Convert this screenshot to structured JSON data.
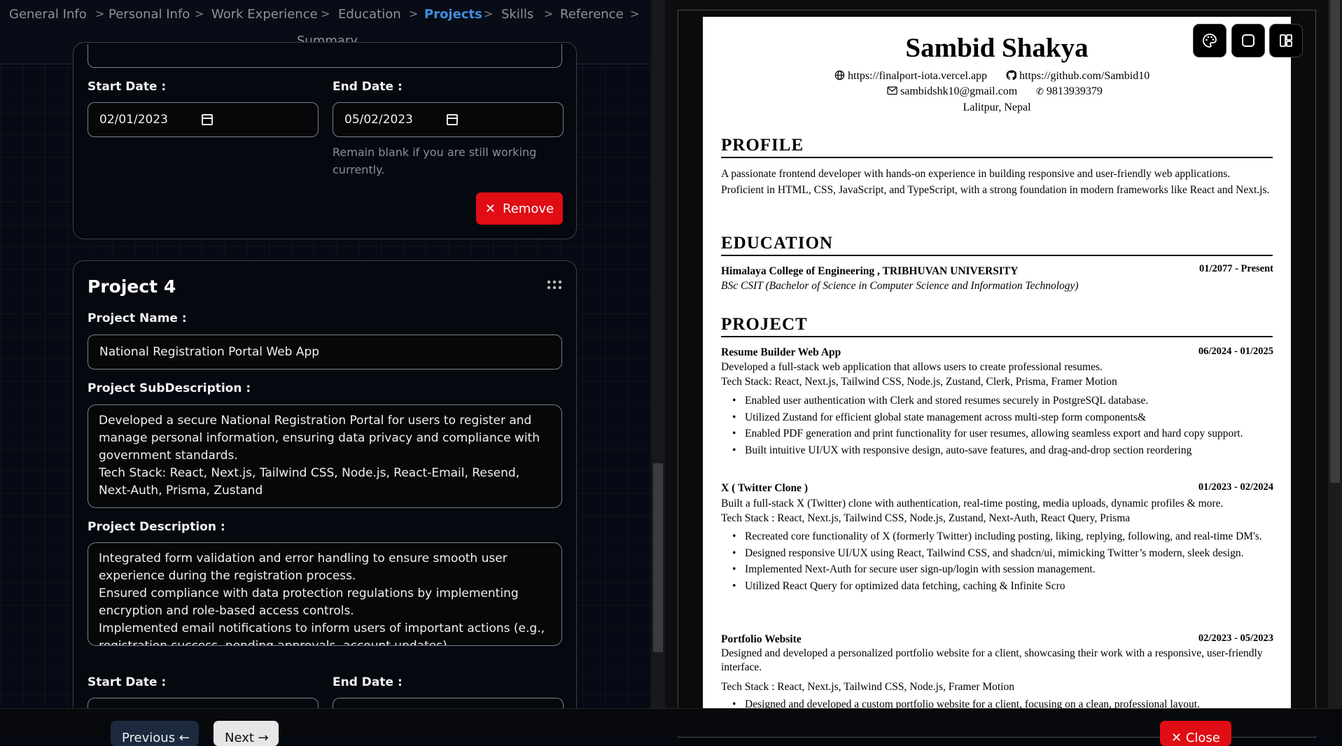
{
  "stepper": {
    "steps": [
      "General Info",
      "Personal Info",
      "Work Experience",
      "Education",
      "Projects",
      "Skills",
      "Reference",
      "Summary"
    ],
    "active": "Projects"
  },
  "project3": {
    "start_label": "Start Date :",
    "start_value": "02/01/2023",
    "end_label": "End Date :",
    "end_value": "05/02/2023",
    "end_hint": "Remain blank if you are still working currently.",
    "remove_label": "Remove"
  },
  "project4": {
    "title": "Project 4",
    "name_label": "Project Name :",
    "name_value": "National Registration Portal Web App",
    "subdesc_label": "Project SubDescription :",
    "subdesc_value": "Developed a secure National Registration Portal for users to register and manage personal information, ensuring data privacy and compliance with government standards.\nTech Stack: React, Next.js, Tailwind CSS, Node.js, React-Email, Resend, Next-Auth, Prisma, Zustand",
    "desc_label": "Project Description :",
    "desc_value": "Integrated form validation and error handling to ensure smooth user experience during the registration process.\nEnsured compliance with data protection regulations by implementing encryption and role-based access controls.\nImplemented email notifications to inform users of important actions (e.g., registration success, pending approvals, account updates).",
    "start_label": "Start Date :",
    "end_label": "End Date :"
  },
  "footer": {
    "previous": "Previous",
    "next": "Next",
    "close": "Close"
  },
  "toolbar_icons": [
    "palette-icon",
    "square-icon",
    "layout-icon"
  ],
  "resume": {
    "name": "Sambid Shakya",
    "website": "https://finalport-iota.vercel.app",
    "github": "https://github.com/Sambid10",
    "email": "sambidshk10@gmail.com",
    "phone": "9813939379",
    "location": "Lalitpur, Nepal",
    "profile_heading": "PROFILE",
    "profile_text": "A passionate frontend developer with hands-on experience in building responsive and user-friendly web applications. Proficient in HTML, CSS, JavaScript, and TypeScript, with a strong foundation in modern frameworks like React and Next.js.",
    "education_heading": "EDUCATION",
    "education": {
      "school": "Himalaya College of Engineering , TRIBHUVAN UNIVERSITY",
      "date": "01/2077 - Present",
      "degree": "BSc CSIT (Bachelor of Science in Computer Science and Information Technology)"
    },
    "project_heading": "PROJECT",
    "projects": [
      {
        "name": "Resume Builder Web App",
        "date": "06/2024 - 01/2025",
        "desc": "Developed a full-stack web application that allows users to create professional resumes.",
        "stack": "Tech Stack: React, Next.js, Tailwind CSS, Node.js, Zustand, Clerk, Prisma, Framer Motion",
        "bullets": [
          "Enabled user authentication with Clerk and stored resumes securely in PostgreSQL database.",
          "Utilized Zustand for efficient global state management across multi-step form components&",
          "Enabled PDF generation and print functionality for user resumes, allowing seamless export and hard copy support.",
          "Built intuitive UI/UX with responsive design, auto-save features, and drag-and-drop section reordering"
        ]
      },
      {
        "name": "X ( Twitter Clone )",
        "date": "01/2023 - 02/2024",
        "desc": "Built a full-stack X (Twitter) clone with authentication, real-time posting, media uploads, dynamic profiles & more.",
        "stack": "Tech Stack : React, Next.js, Tailwind CSS, Node.js, Zustand, Next-Auth, React Query, Prisma",
        "bullets": [
          "Recreated core functionality of X (formerly Twitter) including posting, liking, replying, following, and real-time DM's.",
          "Designed responsive UI/UX using React, Tailwind CSS, and shadcn/ui, mimicking Twitter’s modern, sleek design.",
          "Implemented Next-Auth for secure user sign-up/login with session management.",
          "Utilized React Query for optimized data fetching, caching & Infinite Scro"
        ]
      },
      {
        "name": "Portfolio Website",
        "date": "02/2023 - 05/2023",
        "desc": "Designed and developed a personalized portfolio website for a client, showcasing their work with a responsive, user-friendly interface.",
        "stack": "Tech Stack : React, Next.js, Tailwind CSS, Node.js, Framer Motion",
        "bullets": [
          "Designed and developed a custom portfolio website for a client, focusing on a clean, professional layout."
        ]
      }
    ]
  }
}
